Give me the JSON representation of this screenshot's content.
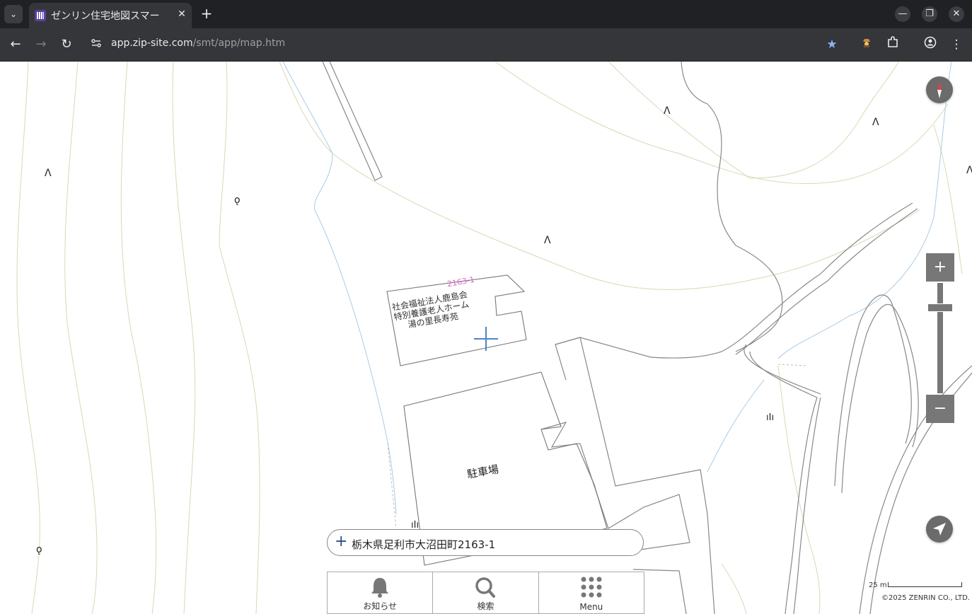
{
  "browser": {
    "tab_menu_icon": "chevron-down-icon",
    "tab": {
      "title": "ゼンリン住宅地図スマー",
      "favicon": "zenrin-favicon",
      "close": "✕"
    },
    "new_tab": "+",
    "window": {
      "minimize": "—",
      "restore": "❐",
      "close": "✕"
    },
    "url": {
      "host": "app.zip-site.com",
      "path": "/smt/app/map.htm"
    },
    "nav": {
      "back": "←",
      "forward": "→",
      "reload": "↻"
    },
    "toolbar_icons": [
      "star-icon",
      "spy-extension-icon",
      "puzzle-icon",
      "profile-icon",
      "more-vert-icon"
    ]
  },
  "map": {
    "facility_label": [
      "社会福祉法人鹿島会",
      "特別養護老人ホーム",
      "湯の里長寿苑"
    ],
    "lot_number": "2163-1",
    "parking_label": "駐車場",
    "colors": {
      "contour": "#d9d8b6",
      "river": "#a9cbe6",
      "road": "#888888",
      "crosshair": "#4a86c7",
      "lot_number": "#e060c0"
    }
  },
  "controls": {
    "zoom_in": "+",
    "zoom_out": "−",
    "address": "栃木県足利市大沼田町2163-1",
    "address_icon": "plus-icon"
  },
  "bottom_menu": [
    {
      "label": "お知らせ",
      "icon": "bell-icon"
    },
    {
      "label": "検索",
      "icon": "search-icon"
    },
    {
      "label": "Menu",
      "icon": "grid-icon"
    }
  ],
  "scale_label": "25 m",
  "copyright": "©2025 ZENRIN CO., LTD."
}
